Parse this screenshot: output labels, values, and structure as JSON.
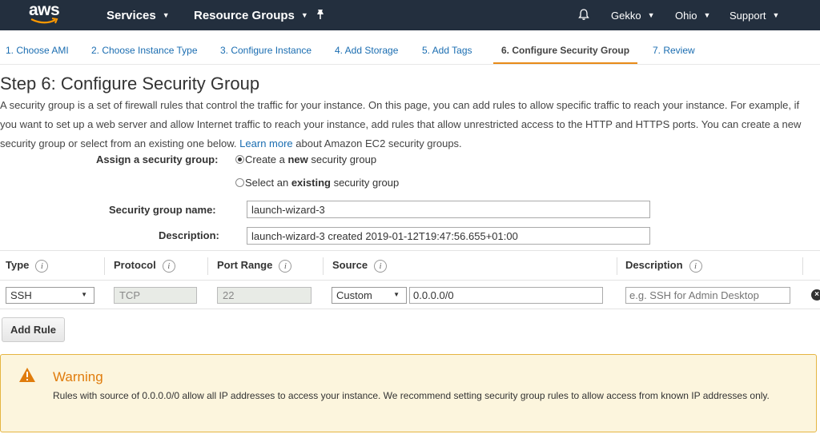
{
  "topnav": {
    "logo_text": "aws",
    "services": "Services",
    "resource_groups": "Resource Groups",
    "user": "Gekko",
    "region": "Ohio",
    "support": "Support"
  },
  "tabs": [
    {
      "label": "1. Choose AMI"
    },
    {
      "label": "2. Choose Instance Type"
    },
    {
      "label": "3. Configure Instance"
    },
    {
      "label": "4. Add Storage"
    },
    {
      "label": "5. Add Tags"
    },
    {
      "label": "6. Configure Security Group",
      "active": true
    },
    {
      "label": "7. Review"
    }
  ],
  "page": {
    "title": "Step 6: Configure Security Group",
    "intro_text": "A security group is a set of firewall rules that control the traffic for your instance. On this page, you can add rules to allow specific traffic to reach your instance. For example, if you want to set up a web server and allow Internet traffic to reach your instance, add rules that allow unrestricted access to the HTTP and HTTPS ports. You can create a new security group or select from an existing one below.",
    "learn_more": "Learn more",
    "intro_tail": "about Amazon EC2 security groups."
  },
  "assign": {
    "label": "Assign a security group:",
    "option_new_pre": "Create a ",
    "option_new_bold": "new",
    "option_new_post": " security group",
    "option_existing_pre": "Select an ",
    "option_existing_bold": "existing",
    "option_existing_post": " security group",
    "selected": "new"
  },
  "group": {
    "name_label": "Security group name:",
    "name_value": "launch-wizard-3",
    "desc_label": "Description:",
    "desc_value": "launch-wizard-3 created 2019-01-12T19:47:56.655+01:00"
  },
  "table": {
    "headers": {
      "type": "Type",
      "protocol": "Protocol",
      "port_range": "Port Range",
      "source": "Source",
      "description": "Description"
    },
    "info_glyph": "i",
    "rows": [
      {
        "type": "SSH",
        "protocol": "TCP",
        "port_range": "22",
        "source_type": "Custom",
        "source_cidr": "0.0.0.0/0",
        "description_placeholder": "e.g. SSH for Admin Desktop"
      }
    ]
  },
  "add_rule_label": "Add Rule",
  "warning": {
    "title": "Warning",
    "text": "Rules with source of 0.0.0.0/0 allow all IP addresses to access your instance. We recommend setting security group rules to allow access from known IP addresses only."
  },
  "colors": {
    "nav_bg": "#232f3e",
    "link": "#1a6db1",
    "accent": "#e88b18",
    "warning_bg": "#fcf5dd",
    "warning_border": "#e5b541"
  }
}
